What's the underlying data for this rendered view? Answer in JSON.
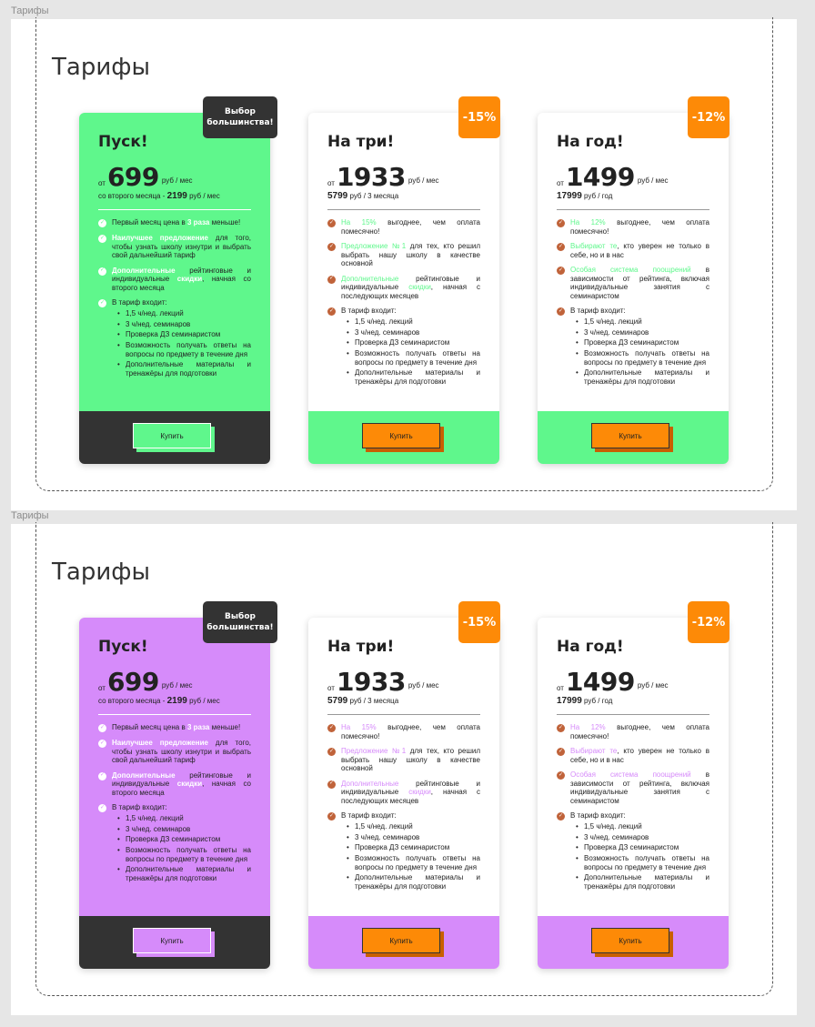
{
  "frames": [
    {
      "label": "Тарифы",
      "title": "Тарифы",
      "accent": "#5ff78c",
      "cards": [
        {
          "badge": "Выбор большинства!",
          "title": "Пуск!",
          "from": "от",
          "price": "699",
          "unit": "руб / мес",
          "sub_prefix": "со второго месяца -",
          "sub_price": "2199",
          "sub_unit": "руб / мес",
          "features": [
            {
              "hl": "",
              "pre": "Первый месяц цена в ",
              "hl2": "3 раза",
              "post": " меньше!"
            },
            {
              "hl": "Наилучшее предложение",
              "pre": "",
              "hl2": "",
              "post": " для того, чтобы узнать школу изнутри и выбрать свой дальнейший тариф"
            },
            {
              "hl": "Дополнительные",
              "pre": " рейтинговые и индивидуальные ",
              "hl2": "скидки",
              "post": ", начная со второго месяца"
            },
            {
              "hl": "",
              "pre": "В тариф входит:",
              "hl2": "",
              "post": ""
            }
          ],
          "includes": [
            "1,5 ч/нед. лекций",
            "3 ч/нед. семинаров",
            "Проверка ДЗ семинаристом",
            "Возможность получать ответы на вопросы по предмету в течение дня",
            "Дополнительные материалы и тренажёры для подготовки"
          ],
          "button": "Купить"
        },
        {
          "badge": "-15%",
          "title": "На три!",
          "from": "от",
          "price": "1933",
          "unit": "руб / мес",
          "sub_prefix": "",
          "sub_price": "5799",
          "sub_unit": "руб / 3 месяца",
          "features": [
            {
              "hl": "На 15%",
              "pre": " выгоднее, чем оплата помесячно!",
              "hl2": "",
              "post": ""
            },
            {
              "hl": "Предложение №1",
              "pre": " для тех, кто решил выбрать нашу школу в качестве основной",
              "hl2": "",
              "post": ""
            },
            {
              "hl": "Дополнительные",
              "pre": " рейтинговые и индивидуальные ",
              "hl2": "скидки",
              "post": ", начная с последующих месяцев"
            },
            {
              "hl": "",
              "pre": "В тариф входит:",
              "hl2": "",
              "post": ""
            }
          ],
          "includes": [
            "1,5 ч/нед. лекций",
            "3 ч/нед. семинаров",
            "Проверка ДЗ семинаристом",
            "Возможность получать ответы на вопросы по предмету в течение дня",
            "Дополнительные материалы и тренажёры для подготовки"
          ],
          "button": "Купить"
        },
        {
          "badge": "-12%",
          "title": "На год!",
          "from": "от",
          "price": "1499",
          "unit": "руб / мес",
          "sub_prefix": "",
          "sub_price": "17999",
          "sub_unit": "руб / год",
          "features": [
            {
              "hl": "На 12%",
              "pre": " выгоднее, чем оплата помесячно!",
              "hl2": "",
              "post": ""
            },
            {
              "hl": "Выбирают те",
              "pre": ", кто уверен не только в себе, но и в нас",
              "hl2": "",
              "post": ""
            },
            {
              "hl": "Особая система поощрений",
              "pre": " в зависимости от рейтинга, включая индивидуальные занятия с семинаристом",
              "hl2": "",
              "post": ""
            },
            {
              "hl": "",
              "pre": "В тариф входит:",
              "hl2": "",
              "post": ""
            }
          ],
          "includes": [
            "1,5 ч/нед. лекций",
            "3 ч/нед. семинаров",
            "Проверка ДЗ семинаристом",
            "Возможность получать ответы на вопросы по предмету в течение дня",
            "Дополнительные материалы и тренажёры для подготовки"
          ],
          "button": "Купить"
        }
      ]
    },
    {
      "label": "Тарифы",
      "title": "Тарифы",
      "accent": "#d68bfa",
      "cards": [
        {
          "badge": "Выбор большинства!",
          "title": "Пуск!",
          "from": "от",
          "price": "699",
          "unit": "руб / мес",
          "sub_prefix": "со второго месяца -",
          "sub_price": "2199",
          "sub_unit": "руб / мес",
          "features": [
            {
              "hl": "",
              "pre": "Первый месяц цена в ",
              "hl2": "3 раза",
              "post": " меньше!"
            },
            {
              "hl": "Наилучшее предложение",
              "pre": "",
              "hl2": "",
              "post": " для того, чтобы узнать школу изнутри и выбрать свой дальнейший тариф"
            },
            {
              "hl": "Дополнительные",
              "pre": " рейтинговые и индивидуальные ",
              "hl2": "скидки",
              "post": ", начная со второго месяца"
            },
            {
              "hl": "",
              "pre": "В тариф входит:",
              "hl2": "",
              "post": ""
            }
          ],
          "includes": [
            "1,5 ч/нед. лекций",
            "3 ч/нед. семинаров",
            "Проверка ДЗ семинаристом",
            "Возможность получать ответы на вопросы по предмету в течение дня",
            "Дополнительные материалы и тренажёры для подготовки"
          ],
          "button": "Купить"
        },
        {
          "badge": "-15%",
          "title": "На три!",
          "from": "от",
          "price": "1933",
          "unit": "руб / мес",
          "sub_prefix": "",
          "sub_price": "5799",
          "sub_unit": "руб / 3 месяца",
          "features": [
            {
              "hl": "На 15%",
              "pre": " выгоднее, чем оплата помесячно!",
              "hl2": "",
              "post": ""
            },
            {
              "hl": "Предложение №1",
              "pre": " для тех, кто решил выбрать нашу школу в качестве основной",
              "hl2": "",
              "post": ""
            },
            {
              "hl": "Дополнительные",
              "pre": " рейтинговые и индивидуальные ",
              "hl2": "скидки",
              "post": ", начная с последующих месяцев"
            },
            {
              "hl": "",
              "pre": "В тариф входит:",
              "hl2": "",
              "post": ""
            }
          ],
          "includes": [
            "1,5 ч/нед. лекций",
            "3 ч/нед. семинаров",
            "Проверка ДЗ семинаристом",
            "Возможность получать ответы на вопросы по предмету в течение дня",
            "Дополнительные материалы и тренажёры для подготовки"
          ],
          "button": "Купить"
        },
        {
          "badge": "-12%",
          "title": "На год!",
          "from": "от",
          "price": "1499",
          "unit": "руб / мес",
          "sub_prefix": "",
          "sub_price": "17999",
          "sub_unit": "руб / год",
          "features": [
            {
              "hl": "На 12%",
              "pre": " выгоднее, чем оплата помесячно!",
              "hl2": "",
              "post": ""
            },
            {
              "hl": "Выбирают те",
              "pre": ", кто уверен не только в себе, но и в нас",
              "hl2": "",
              "post": ""
            },
            {
              "hl": "Особая система поощрений",
              "pre": " в зависимости от рейтинга, включая индивидуальные занятия с семинаристом",
              "hl2": "",
              "post": ""
            },
            {
              "hl": "",
              "pre": "В тариф входит:",
              "hl2": "",
              "post": ""
            }
          ],
          "includes": [
            "1,5 ч/нед. лекций",
            "3 ч/нед. семинаров",
            "Проверка ДЗ семинаристом",
            "Возможность получать ответы на вопросы по предмету в течение дня",
            "Дополнительные материалы и тренажёры для подготовки"
          ],
          "button": "Купить"
        }
      ]
    }
  ],
  "colors": {
    "dark": "#333333",
    "orange": "#fd8a07",
    "check": "#c0633a",
    "green_accent": "#5ff78c",
    "violet_accent": "#d68bfa"
  },
  "icons": {
    "check": "check-circle-icon"
  }
}
